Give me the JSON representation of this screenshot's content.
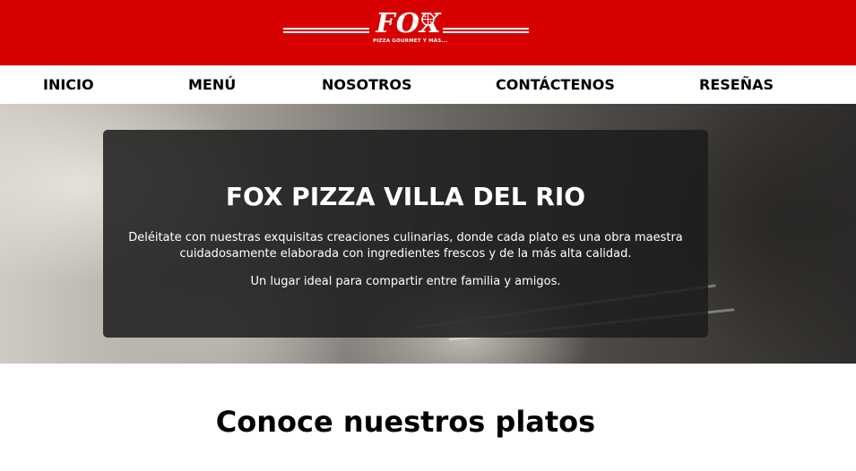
{
  "header": {
    "logo_word": "FOX",
    "logo_tagline": "PIZZA GOURMET Y MÁS...",
    "colors": {
      "brand_red": "#d70000",
      "text_white": "#ffffff"
    }
  },
  "nav": {
    "items": [
      {
        "label": "INICIO"
      },
      {
        "label": "MENÚ"
      },
      {
        "label": "NOSOTROS"
      },
      {
        "label": "CONTÁCTENOS"
      },
      {
        "label": "RESEÑAS"
      }
    ]
  },
  "hero": {
    "title": "FOX PIZZA VILLA DEL RIO",
    "paragraph_1": "Deléitate con nuestras exquisitas creaciones culinarias, donde cada plato es una obra maestra cuidadosamente elaborada con ingredientes frescos y de la más alta calidad.",
    "paragraph_2": "Un lugar ideal para compartir entre familia y amigos."
  },
  "section": {
    "title": "Conoce nuestros platos"
  }
}
